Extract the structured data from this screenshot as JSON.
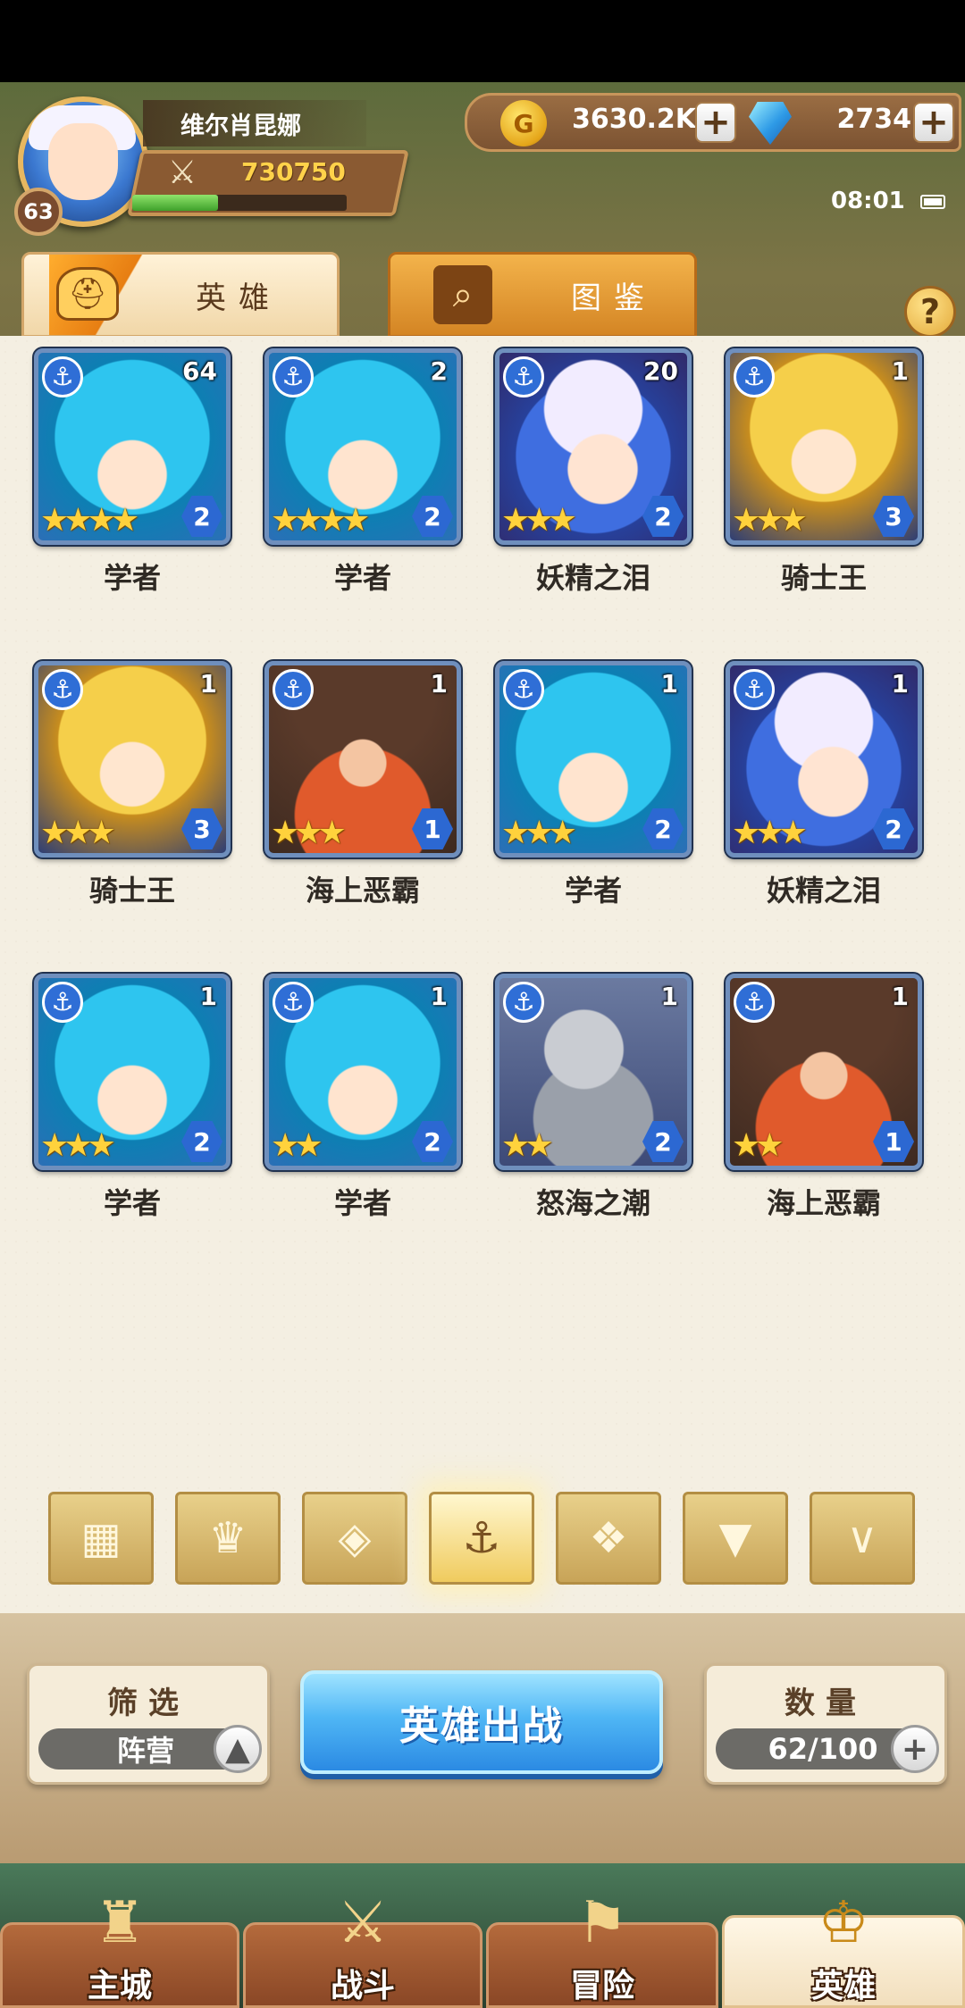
{
  "player": {
    "name": "维尔肖昆娜",
    "level": "63",
    "power": "730750",
    "xp_fraction": 0.4
  },
  "resources": {
    "gold": "3630.2K",
    "gold_icon_letter": "G",
    "gems": "2734",
    "plus": "+"
  },
  "clock": "08:01",
  "tabs": {
    "heroes": "英雄",
    "codex": "图鉴",
    "help": "?"
  },
  "heroes": [
    {
      "name": "学者",
      "count": "64",
      "stars": "★★★★",
      "grade": "2",
      "art": "scholar"
    },
    {
      "name": "学者",
      "count": "2",
      "stars": "★★★★",
      "grade": "2",
      "art": "scholar"
    },
    {
      "name": "妖精之泪",
      "count": "20",
      "stars": "★★★",
      "grade": "2",
      "art": "fairy"
    },
    {
      "name": "骑士王",
      "count": "1",
      "stars": "★★★",
      "grade": "3",
      "art": "knight"
    },
    {
      "name": "骑士王",
      "count": "1",
      "stars": "★★★",
      "grade": "3",
      "art": "knight"
    },
    {
      "name": "海上恶霸",
      "count": "1",
      "stars": "★★★",
      "grade": "1",
      "art": "pirate"
    },
    {
      "name": "学者",
      "count": "1",
      "stars": "★★★",
      "grade": "2",
      "art": "scholar"
    },
    {
      "name": "妖精之泪",
      "count": "1",
      "stars": "★★★",
      "grade": "2",
      "art": "fairy"
    },
    {
      "name": "学者",
      "count": "1",
      "stars": "★★★",
      "grade": "2",
      "art": "scholar"
    },
    {
      "name": "学者",
      "count": "1",
      "stars": "★★",
      "grade": "2",
      "art": "scholar"
    },
    {
      "name": "怒海之潮",
      "count": "1",
      "stars": "★★",
      "grade": "2",
      "art": "armor"
    },
    {
      "name": "海上恶霸",
      "count": "1",
      "stars": "★★",
      "grade": "1",
      "art": "pirate"
    }
  ],
  "faction_icon": "⚓",
  "filters": [
    {
      "icon": "grid-icon",
      "glyph": "▦",
      "active": false
    },
    {
      "icon": "crown-icon",
      "glyph": "♛",
      "active": false
    },
    {
      "icon": "diamond-icon",
      "glyph": "◈",
      "active": false
    },
    {
      "icon": "anchor-icon",
      "glyph": "⚓",
      "active": true
    },
    {
      "icon": "beast-icon",
      "glyph": "❖",
      "active": false
    },
    {
      "icon": "wolf-icon",
      "glyph": "▼",
      "active": false
    },
    {
      "icon": "wing-icon",
      "glyph": "∨",
      "active": false
    }
  ],
  "controls": {
    "filter_title": "筛选",
    "filter_value": "阵营",
    "filter_toggle": "▲",
    "deploy_label": "英雄出战",
    "count_title": "数量",
    "count_value": "62/100",
    "count_plus": "+"
  },
  "nav": [
    {
      "label": "主城",
      "icon": "castle-icon",
      "glyph": "♜",
      "active": false
    },
    {
      "label": "战斗",
      "icon": "swords-icon",
      "glyph": "⚔",
      "active": false
    },
    {
      "label": "冒险",
      "icon": "map-icon",
      "glyph": "⚑",
      "active": false
    },
    {
      "label": "英雄",
      "icon": "hero-crest-icon",
      "glyph": "♔",
      "active": true
    }
  ]
}
